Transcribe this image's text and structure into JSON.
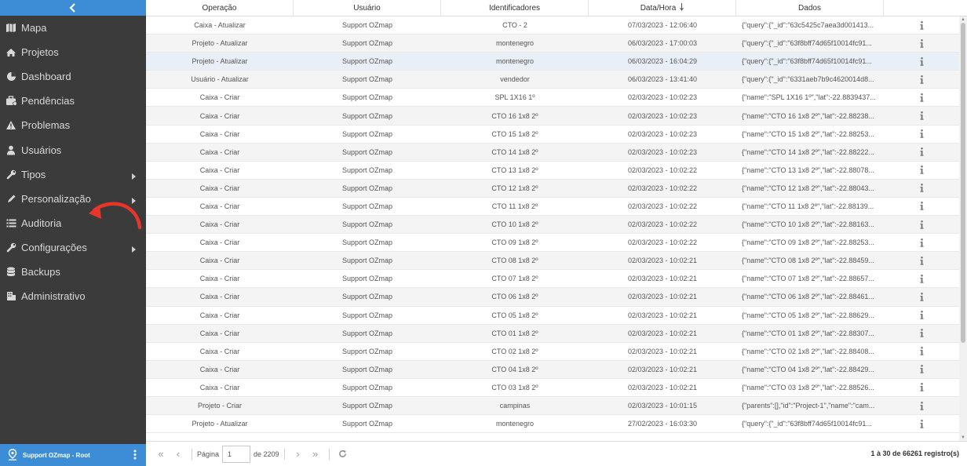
{
  "sidebar": {
    "collapse_icon": "chevron-left-icon",
    "items": [
      {
        "label": "Mapa",
        "icon": "map-icon"
      },
      {
        "label": "Projetos",
        "icon": "home-icon"
      },
      {
        "label": "Dashboard",
        "icon": "pie-chart-icon"
      },
      {
        "label": "Pendências",
        "icon": "briefcase-icon"
      },
      {
        "label": "Problemas",
        "icon": "warning-icon"
      },
      {
        "label": "Usuários",
        "icon": "user-icon"
      },
      {
        "label": "Tipos",
        "icon": "wrench-icon",
        "has_submenu": true
      },
      {
        "label": "Personalização",
        "icon": "pencil-icon",
        "has_submenu": true
      },
      {
        "label": "Auditoria",
        "icon": "list-icon"
      },
      {
        "label": "Configurações",
        "icon": "wrench-icon",
        "has_submenu": true
      },
      {
        "label": "Backups",
        "icon": "database-icon"
      },
      {
        "label": "Administrativo",
        "icon": "building-icon"
      }
    ],
    "user": {
      "name": "Support OZmap - Root",
      "icon": "map-pin-icon",
      "menu_icon": "vertical-dots-icon"
    }
  },
  "colors": {
    "sidebar_bg": "#3b3b3b",
    "accent": "#3c8dd6",
    "annotation_arrow": "#e8352a"
  },
  "table": {
    "columns": [
      "Operação",
      "Usuário",
      "Identificadores",
      "Data/Hora",
      "Dados",
      ""
    ],
    "sort_column": "Data/Hora",
    "sort_direction": "descending",
    "rows": [
      {
        "op": "Caixa - Atualizar",
        "user": "Support OZmap",
        "id": "CTO - 2",
        "date": "07/03/2023 - 12:06:40",
        "data": "{\"query\":{\"_id\":\"63c5425c7aea3d001413..."
      },
      {
        "op": "Projeto - Atualizar",
        "user": "Support OZmap",
        "id": "montenegro",
        "date": "06/03/2023 - 17:00:03",
        "data": "{\"query\":{\"_id\":\"63f8bff74d65f10014fc91..."
      },
      {
        "op": "Projeto - Atualizar",
        "user": "Support OZmap",
        "id": "montenegro",
        "date": "06/03/2023 - 16:04:29",
        "data": "{\"query\":{\"_id\":\"63f8bff74d65f10014fc91..."
      },
      {
        "op": "Usuário - Atualizar",
        "user": "Support OZmap",
        "id": "vendedor",
        "date": "06/03/2023 - 13:41:40",
        "data": "{\"query\":{\"_id\":\"6331aeb7b9c4620014d8..."
      },
      {
        "op": "Caixa - Criar",
        "user": "Support OZmap",
        "id": "SPL 1X16 1º",
        "date": "02/03/2023 - 10:02:23",
        "data": "{\"name\":\"SPL 1X16 1º\",\"lat\":-22.8839437..."
      },
      {
        "op": "Caixa - Criar",
        "user": "Support OZmap",
        "id": "CTO 16 1x8 2º",
        "date": "02/03/2023 - 10:02:23",
        "data": "{\"name\":\"CTO 16 1x8 2º\",\"lat\":-22.88238..."
      },
      {
        "op": "Caixa - Criar",
        "user": "Support OZmap",
        "id": "CTO 15 1x8 2º",
        "date": "02/03/2023 - 10:02:23",
        "data": "{\"name\":\"CTO 15 1x8 2º\",\"lat\":-22.88253..."
      },
      {
        "op": "Caixa - Criar",
        "user": "Support OZmap",
        "id": "CTO 14 1x8 2º",
        "date": "02/03/2023 - 10:02:23",
        "data": "{\"name\":\"CTO 14 1x8 2º\",\"lat\":-22.88222..."
      },
      {
        "op": "Caixa - Criar",
        "user": "Support OZmap",
        "id": "CTO 13 1x8 2º",
        "date": "02/03/2023 - 10:02:22",
        "data": "{\"name\":\"CTO 13 1x8 2º\",\"lat\":-22.88078..."
      },
      {
        "op": "Caixa - Criar",
        "user": "Support OZmap",
        "id": "CTO 12 1x8 2º",
        "date": "02/03/2023 - 10:02:22",
        "data": "{\"name\":\"CTO 12 1x8 2º\",\"lat\":-22.88043..."
      },
      {
        "op": "Caixa - Criar",
        "user": "Support OZmap",
        "id": "CTO 11 1x8 2º",
        "date": "02/03/2023 - 10:02:22",
        "data": "{\"name\":\"CTO 11 1x8 2º\",\"lat\":-22.88139..."
      },
      {
        "op": "Caixa - Criar",
        "user": "Support OZmap",
        "id": "CTO 10 1x8 2º",
        "date": "02/03/2023 - 10:02:22",
        "data": "{\"name\":\"CTO 10 1x8 2º\",\"lat\":-22.88163..."
      },
      {
        "op": "Caixa - Criar",
        "user": "Support OZmap",
        "id": "CTO 09 1x8 2º",
        "date": "02/03/2023 - 10:02:22",
        "data": "{\"name\":\"CTO 09 1x8 2º\",\"lat\":-22.88253..."
      },
      {
        "op": "Caixa - Criar",
        "user": "Support OZmap",
        "id": "CTO 08 1x8 2º",
        "date": "02/03/2023 - 10:02:21",
        "data": "{\"name\":\"CTO 08 1x8 2º\",\"lat\":-22.88459..."
      },
      {
        "op": "Caixa - Criar",
        "user": "Support OZmap",
        "id": "CTO 07 1x8 2º",
        "date": "02/03/2023 - 10:02:21",
        "data": "{\"name\":\"CTO 07 1x8 2º\",\"lat\":-22.88657..."
      },
      {
        "op": "Caixa - Criar",
        "user": "Support OZmap",
        "id": "CTO 06 1x8 2º",
        "date": "02/03/2023 - 10:02:21",
        "data": "{\"name\":\"CTO 06 1x8 2º\",\"lat\":-22.88461..."
      },
      {
        "op": "Caixa - Criar",
        "user": "Support OZmap",
        "id": "CTO 05 1x8 2º",
        "date": "02/03/2023 - 10:02:21",
        "data": "{\"name\":\"CTO 05 1x8 2º\",\"lat\":-22.88629..."
      },
      {
        "op": "Caixa - Criar",
        "user": "Support OZmap",
        "id": "CTO 01 1x8 2º",
        "date": "02/03/2023 - 10:02:21",
        "data": "{\"name\":\"CTO 01 1x8 2º\",\"lat\":-22.88307..."
      },
      {
        "op": "Caixa - Criar",
        "user": "Support OZmap",
        "id": "CTO 02 1x8 2º",
        "date": "02/03/2023 - 10:02:21",
        "data": "{\"name\":\"CTO 02 1x8 2º\",\"lat\":-22.88408..."
      },
      {
        "op": "Caixa - Criar",
        "user": "Support OZmap",
        "id": "CTO 04 1x8 2º",
        "date": "02/03/2023 - 10:02:21",
        "data": "{\"name\":\"CTO 04 1x8 2º\",\"lat\":-22.88429..."
      },
      {
        "op": "Caixa - Criar",
        "user": "Support OZmap",
        "id": "CTO 03 1x8 2º",
        "date": "02/03/2023 - 10:02:21",
        "data": "{\"name\":\"CTO 03 1x8 2º\",\"lat\":-22.88526..."
      },
      {
        "op": "Projeto - Criar",
        "user": "Support OZmap",
        "id": "campinas",
        "date": "02/03/2023 - 10:01:15",
        "data": "{\"parents\":[],\"id\":\"Project-1\",\"name\":\"cam..."
      },
      {
        "op": "Projeto - Atualizar",
        "user": "Support OZmap",
        "id": "montenegro",
        "date": "27/02/2023 - 16:03:30",
        "data": "{\"query\":{\"_id\":\"63f8bff74d65f10014fc91..."
      }
    ]
  },
  "pager": {
    "page_label": "Página",
    "page_value": "1",
    "of_label": "de 2209",
    "summary": "1 à 30 de 66261 registro(s)"
  }
}
